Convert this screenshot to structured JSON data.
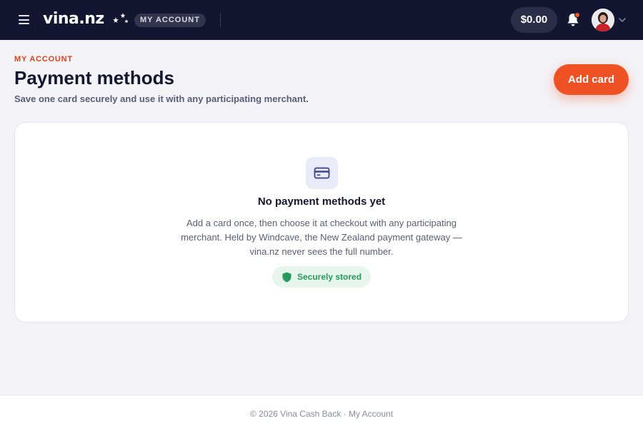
{
  "header": {
    "logo_text": "vina.nz",
    "section_pill": "MY ACCOUNT",
    "balance": "$0.00"
  },
  "page": {
    "eyebrow": "MY ACCOUNT",
    "title": "Payment methods",
    "subtitle": "Save one card securely and use it with any participating merchant.",
    "add_button": "Add card"
  },
  "empty_state": {
    "title": "No payment methods yet",
    "description": "Add a card once, then choose it at checkout with any participating merchant. Held by Windcave, the New Zealand payment gateway — vina.nz never sees the full number.",
    "badge": "Securely stored"
  },
  "footer": {
    "text": "© 2026 Vina Cash Back · My Account"
  },
  "colors": {
    "topbar": "#141531",
    "accent": "#f05124",
    "eyebrow": "#d8431c",
    "secure_green": "#27995a",
    "notification_dot": "#f0562a"
  },
  "icons": [
    "menu-icon",
    "stars-icon",
    "bell-icon",
    "chevron-down-icon",
    "credit-card-icon",
    "shield-icon"
  ]
}
